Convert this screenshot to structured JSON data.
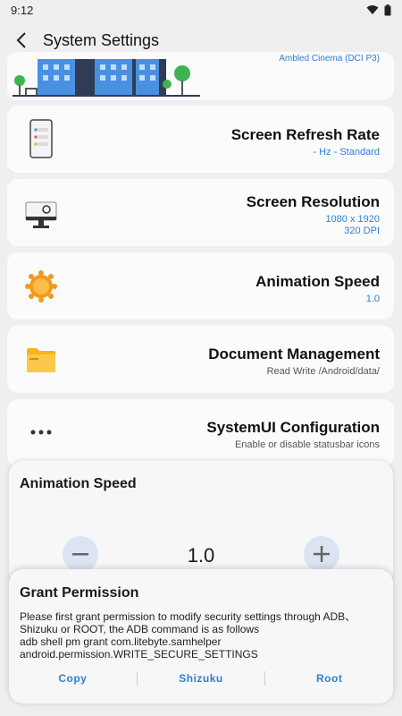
{
  "status": {
    "time": "9:12"
  },
  "header": {
    "title": "System Settings"
  },
  "top_card": {
    "subtitle": "Ambled Cinema (DCI P3)"
  },
  "cards": [
    {
      "title": "Screen Refresh Rate",
      "sub1": "- Hz - Standard",
      "sub2": "",
      "icon": "phone-icon"
    },
    {
      "title": "Screen Resolution",
      "sub1": "1080 x 1920",
      "sub2": "320 DPI",
      "icon": "monitor-icon"
    },
    {
      "title": "Animation Speed",
      "sub1": "1.0",
      "sub2": "",
      "icon": "gear-sun-icon"
    },
    {
      "title": "Document Management",
      "sub1": "Read Write /Android/data/",
      "sub2": "",
      "icon": "folder-icon"
    },
    {
      "title": "SystemUI Configuration",
      "sub1": "Enable or disable statusbar icons",
      "sub2": "",
      "icon": "dots-icon"
    }
  ],
  "speed_sheet": {
    "title": "Animation Speed",
    "value": "1.0",
    "minus": "−",
    "plus": "+"
  },
  "grant_sheet": {
    "title": "Grant Permission",
    "line1": "Please first grant permission to modify security settings through ADB、",
    "line2": "Shizuku or ROOT, the ADB command is as follows",
    "line3": "adb shell pm grant com.litebyte.samhelper",
    "line4": "android.permission.WRITE_SECURE_SETTINGS",
    "buttons": {
      "copy": "Copy",
      "shizuku": "Shizuku",
      "root": "Root"
    }
  }
}
